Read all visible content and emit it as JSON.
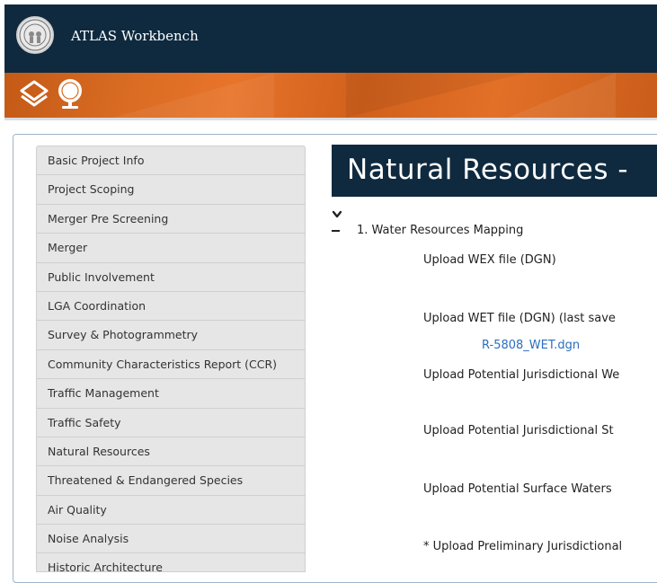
{
  "header": {
    "app_title": "ATLAS Workbench",
    "seal_icon": "nc-state-seal-icon"
  },
  "toolbar": {
    "icons": [
      "layers-icon",
      "globe-icon"
    ]
  },
  "colors": {
    "header_bg": "#0f2a3f",
    "toolbar_orange": "#d86b22",
    "link": "#2a6ebd",
    "sidebar_bg": "#e6e6e6"
  },
  "sidebar": {
    "items": [
      {
        "label": "Basic Project Info"
      },
      {
        "label": "Project Scoping"
      },
      {
        "label": "Merger Pre Screening"
      },
      {
        "label": "Merger"
      },
      {
        "label": "Public Involvement"
      },
      {
        "label": "LGA Coordination"
      },
      {
        "label": "Survey & Photogrammetry"
      },
      {
        "label": "Community Characteristics Report (CCR)"
      },
      {
        "label": "Traffic Management"
      },
      {
        "label": "Traffic Safety"
      },
      {
        "label": "Natural Resources"
      },
      {
        "label": "Threatened & Endangered Species"
      },
      {
        "label": "Air Quality"
      },
      {
        "label": "Noise Analysis"
      },
      {
        "label": "Historic Architecture"
      }
    ]
  },
  "main": {
    "section_title": "Natural Resources -",
    "group_title": "1. Water Resources Mapping",
    "uploads": {
      "wex": "Upload WEX file (DGN)",
      "wet": "Upload WET file (DGN) (last save",
      "wet_file_link": "R-5808_WET.dgn",
      "potential_wetlands": "Upload Potential Jurisdictional We",
      "potential_streams": "Upload Potential Jurisdictional St",
      "potential_surface_waters": "Upload Potential Surface Waters",
      "preliminary_jurisdictional": "* Upload Preliminary Jurisdictional"
    }
  }
}
